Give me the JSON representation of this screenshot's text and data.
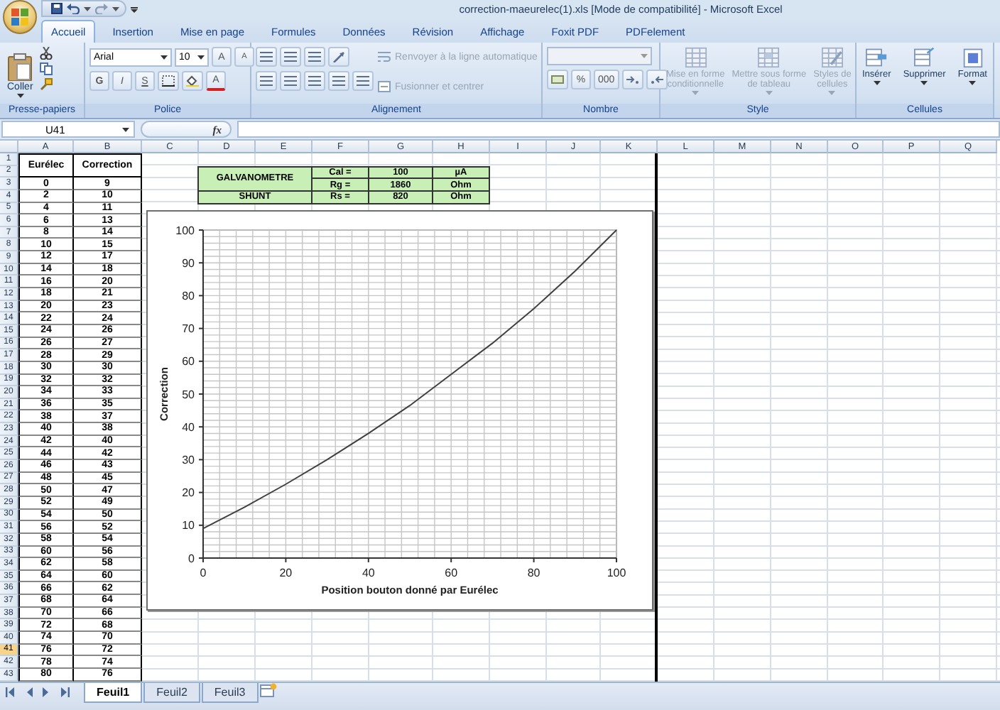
{
  "window": {
    "title": "correction-maeurelec(1).xls  [Mode de compatibilité] - Microsoft Excel"
  },
  "ribbon": {
    "tabs": [
      {
        "label": "Accueil",
        "selected": true
      },
      {
        "label": "Insertion",
        "selected": false
      },
      {
        "label": "Mise en page",
        "selected": false
      },
      {
        "label": "Formules",
        "selected": false
      },
      {
        "label": "Données",
        "selected": false
      },
      {
        "label": "Révision",
        "selected": false
      },
      {
        "label": "Affichage",
        "selected": false
      },
      {
        "label": "Foxit PDF",
        "selected": false
      },
      {
        "label": "PDFelement",
        "selected": false
      }
    ],
    "clipboard": {
      "label": "Presse-papiers",
      "paste": "Coller"
    },
    "font": {
      "label": "Police",
      "font_name": "Arial",
      "font_size": "10",
      "grow": "A",
      "shrink": "A",
      "bold": "G",
      "italic": "I",
      "underline": "S",
      "font_color": "A"
    },
    "alignment": {
      "label": "Alignement",
      "wrap_text": {
        "label": "Renvoyer à la ligne automatique",
        "disabled": true
      },
      "merge": {
        "label": "Fusionner et centrer",
        "disabled": true
      }
    },
    "number": {
      "label": "Nombre",
      "format_disabled": true,
      "percent": "%",
      "thousands": "000"
    },
    "styles": {
      "label": "Style",
      "buttons": [
        {
          "label": "Mise en forme\nconditionnelle",
          "disabled": true
        },
        {
          "label": "Mettre sous forme\nde tableau",
          "disabled": true
        },
        {
          "label": "Styles de\ncellules",
          "disabled": true
        }
      ]
    },
    "cells": {
      "label": "Cellules",
      "buttons": [
        {
          "label": "Insérer",
          "disabled": false
        },
        {
          "label": "Supprimer",
          "disabled": false
        },
        {
          "label": "Format",
          "disabled": false
        }
      ]
    }
  },
  "formula_bar": {
    "name_box": "U41",
    "fx": "fx"
  },
  "sheet": {
    "columns": [
      "A",
      "B",
      "C",
      "D",
      "E",
      "F",
      "G",
      "H",
      "I",
      "J",
      "K",
      "L",
      "M",
      "N",
      "O",
      "P",
      "Q"
    ],
    "rows": [
      {
        "label": "1",
        "selected": false
      },
      {
        "label": "2",
        "selected": false
      },
      {
        "label": "3",
        "selected": false
      },
      {
        "label": "4",
        "selected": false
      },
      {
        "label": "5",
        "selected": false
      },
      {
        "label": "6",
        "selected": false
      },
      {
        "label": "7",
        "selected": false
      },
      {
        "label": "8",
        "selected": false
      },
      {
        "label": "9",
        "selected": false
      },
      {
        "label": "10",
        "selected": false
      },
      {
        "label": "11",
        "selected": false
      },
      {
        "label": "12",
        "selected": false
      },
      {
        "label": "13",
        "selected": false
      },
      {
        "label": "14",
        "selected": false
      },
      {
        "label": "15",
        "selected": false
      },
      {
        "label": "16",
        "selected": false
      },
      {
        "label": "17",
        "selected": false
      },
      {
        "label": "18",
        "selected": false
      },
      {
        "label": "19",
        "selected": false
      },
      {
        "label": "20",
        "selected": false
      },
      {
        "label": "21",
        "selected": false
      },
      {
        "label": "22",
        "selected": false
      },
      {
        "label": "23",
        "selected": false
      },
      {
        "label": "24",
        "selected": false
      },
      {
        "label": "25",
        "selected": false
      },
      {
        "label": "26",
        "selected": false
      },
      {
        "label": "27",
        "selected": false
      },
      {
        "label": "28",
        "selected": false
      },
      {
        "label": "29",
        "selected": false
      },
      {
        "label": "30",
        "selected": false
      },
      {
        "label": "31",
        "selected": false
      },
      {
        "label": "32",
        "selected": false
      },
      {
        "label": "33",
        "selected": false
      },
      {
        "label": "34",
        "selected": false
      },
      {
        "label": "35",
        "selected": false
      },
      {
        "label": "36",
        "selected": false
      },
      {
        "label": "37",
        "selected": false
      },
      {
        "label": "38",
        "selected": false
      },
      {
        "label": "39",
        "selected": false
      },
      {
        "label": "40",
        "selected": false
      },
      {
        "label": "41",
        "selected": true
      },
      {
        "label": "42",
        "selected": false
      },
      {
        "label": "43",
        "selected": false
      }
    ],
    "data_table": {
      "headers": [
        "Eurélec",
        "Correction"
      ],
      "rows": [
        [
          "0",
          "9"
        ],
        [
          "2",
          "10"
        ],
        [
          "4",
          "11"
        ],
        [
          "6",
          "13"
        ],
        [
          "8",
          "14"
        ],
        [
          "10",
          "15"
        ],
        [
          "12",
          "17"
        ],
        [
          "14",
          "18"
        ],
        [
          "16",
          "20"
        ],
        [
          "18",
          "21"
        ],
        [
          "20",
          "23"
        ],
        [
          "22",
          "24"
        ],
        [
          "24",
          "26"
        ],
        [
          "26",
          "27"
        ],
        [
          "28",
          "29"
        ],
        [
          "30",
          "30"
        ],
        [
          "32",
          "32"
        ],
        [
          "34",
          "33"
        ],
        [
          "36",
          "35"
        ],
        [
          "38",
          "37"
        ],
        [
          "40",
          "38"
        ],
        [
          "42",
          "40"
        ],
        [
          "44",
          "42"
        ],
        [
          "46",
          "43"
        ],
        [
          "48",
          "45"
        ],
        [
          "50",
          "47"
        ],
        [
          "52",
          "49"
        ],
        [
          "54",
          "50"
        ],
        [
          "56",
          "52"
        ],
        [
          "58",
          "54"
        ],
        [
          "60",
          "56"
        ],
        [
          "62",
          "58"
        ],
        [
          "64",
          "60"
        ],
        [
          "66",
          "62"
        ],
        [
          "68",
          "64"
        ],
        [
          "70",
          "66"
        ],
        [
          "72",
          "68"
        ],
        [
          "74",
          "70"
        ],
        [
          "76",
          "72"
        ],
        [
          "78",
          "74"
        ],
        [
          "80",
          "76"
        ]
      ]
    },
    "info_table": [
      {
        "name": "GALVANOMETRE",
        "params": [
          [
            "Cal =",
            "100",
            "µA"
          ],
          [
            "Rg =",
            "1860",
            "Ohm"
          ]
        ]
      },
      {
        "name": "SHUNT",
        "params": [
          [
            "Rs =",
            "820",
            "Ohm"
          ]
        ]
      }
    ]
  },
  "chart": {
    "chart_data": {
      "type": "line",
      "xlabel": "Position bouton donné par Eurélec",
      "ylabel": "Correction",
      "x": [
        0,
        10,
        20,
        30,
        40,
        50,
        60,
        70,
        80,
        90,
        100
      ],
      "grid": true,
      "series": [
        {
          "color": "#404040",
          "values": [
            9,
            15.5,
            22.5,
            30,
            38,
            46.5,
            56,
            65.5,
            76,
            87.5,
            100
          ]
        }
      ],
      "xlim": [
        0,
        100
      ],
      "ylim": [
        0,
        100
      ],
      "xticks": [
        0,
        20,
        40,
        60,
        80,
        100
      ],
      "yticks": [
        0,
        10,
        20,
        30,
        40,
        50,
        60,
        70,
        80,
        90,
        100
      ]
    }
  },
  "sheet_tabs": [
    {
      "label": "Feuil1",
      "selected": true
    },
    {
      "label": "Feuil2",
      "selected": false
    },
    {
      "label": "Feuil3",
      "selected": false
    }
  ]
}
